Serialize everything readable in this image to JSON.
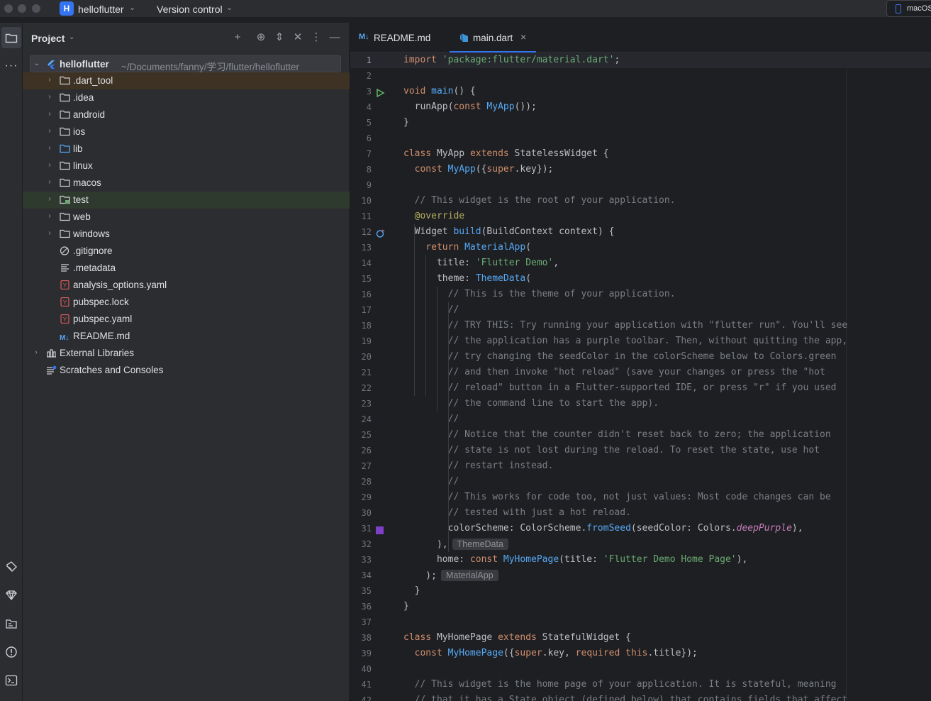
{
  "titlebar": {
    "project_badge": "H",
    "project_name": "helloflutter",
    "vcs": "Version control",
    "device": "macOS"
  },
  "project_panel": {
    "title": "Project",
    "root": {
      "name": "helloflutter",
      "path": "~/Documents/fanny/学习/flutter/helloflutter"
    },
    "items": [
      {
        "label": ".dart_tool",
        "kind": "folder"
      },
      {
        "label": ".idea",
        "kind": "folder"
      },
      {
        "label": "android",
        "kind": "folder"
      },
      {
        "label": "ios",
        "kind": "folder"
      },
      {
        "label": "lib",
        "kind": "folder"
      },
      {
        "label": "linux",
        "kind": "folder"
      },
      {
        "label": "macos",
        "kind": "folder"
      },
      {
        "label": "test",
        "kind": "folder"
      },
      {
        "label": "web",
        "kind": "folder"
      },
      {
        "label": "windows",
        "kind": "folder"
      },
      {
        "label": ".gitignore",
        "kind": "file"
      },
      {
        "label": ".metadata",
        "kind": "file"
      },
      {
        "label": "analysis_options.yaml",
        "kind": "yaml"
      },
      {
        "label": "pubspec.lock",
        "kind": "yaml"
      },
      {
        "label": "pubspec.yaml",
        "kind": "yaml"
      },
      {
        "label": "README.md",
        "kind": "md"
      }
    ],
    "external_libraries": "External Libraries",
    "scratches": "Scratches and Consoles"
  },
  "tabs": [
    {
      "label": "README.md",
      "icon": "markdown-icon",
      "active": false
    },
    {
      "label": "main.dart",
      "icon": "dart-icon",
      "active": true
    }
  ],
  "editor": {
    "current_line": 1,
    "hints": {
      "theme_data": "ThemeData",
      "material_app": "MaterialApp"
    },
    "lines": [
      "import 'package:flutter/material.dart';",
      "",
      "void main() {",
      "  runApp(const MyApp());",
      "}",
      "",
      "class MyApp extends StatelessWidget {",
      "  const MyApp({super.key});",
      "",
      "  // This widget is the root of your application.",
      "  @override",
      "  Widget build(BuildContext context) {",
      "    return MaterialApp(",
      "      title: 'Flutter Demo',",
      "      theme: ThemeData(",
      "        // This is the theme of your application.",
      "        //",
      "        // TRY THIS: Try running your application with \"flutter run\". You'll see",
      "        // the application has a purple toolbar. Then, without quitting the app,",
      "        // try changing the seedColor in the colorScheme below to Colors.green",
      "        // and then invoke \"hot reload\" (save your changes or press the \"hot",
      "        // reload\" button in a Flutter-supported IDE, or press \"r\" if you used",
      "        // the command line to start the app).",
      "        //",
      "        // Notice that the counter didn't reset back to zero; the application",
      "        // state is not lost during the reload. To reset the state, use hot",
      "        // restart instead.",
      "        //",
      "        // This works for code too, not just values: Most code changes can be",
      "        // tested with just a hot reload.",
      "        colorScheme: ColorScheme.fromSeed(seedColor: Colors.deepPurple),",
      "      ),",
      "      home: const MyHomePage(title: 'Flutter Demo Home Page'),",
      "    );",
      "  }",
      "}",
      "",
      "class MyHomePage extends StatefulWidget {",
      "  const MyHomePage({super.key, required this.title});",
      "",
      "  // This widget is the home page of your application. It is stateful, meaning",
      "  // that it has a State object (defined below) that contains fields that affect"
    ],
    "gutter_markers": {
      "3": "run-icon",
      "12": "override-icon",
      "31": "color-swatch"
    },
    "swatch_color": "#7e3fc9"
  },
  "colors": {
    "accent": "#3574f0",
    "bg": "#1e1f22",
    "panel": "#2b2d30"
  }
}
